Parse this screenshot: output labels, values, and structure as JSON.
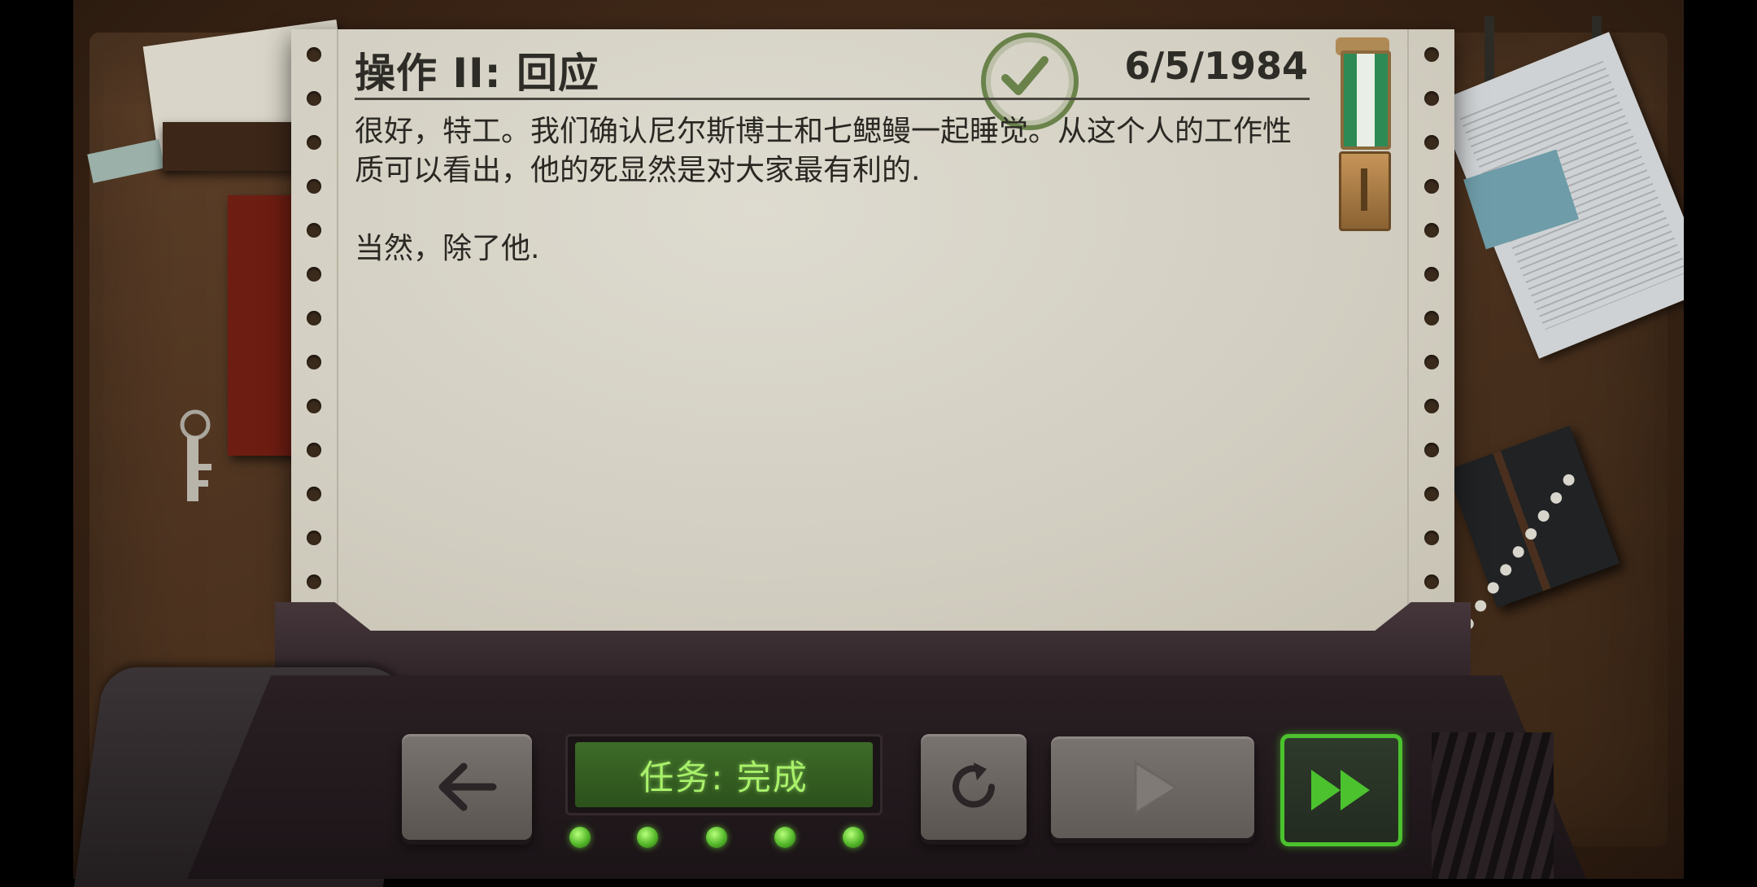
{
  "document": {
    "title": "操作 II: 回应",
    "date": "6/5/1984",
    "body": "很好，特工。我们确认尼尔斯博士和七鳃鳗一起睡觉。从这个人的工作性质可以看出，他的死显然是对大家最有利的.\n\n当然，除了他."
  },
  "status_display": {
    "text": "任务: 完成"
  },
  "controls": {
    "back_icon": "arrow-left-icon",
    "retry_icon": "retry-icon",
    "play_icon": "play-icon",
    "fast_forward_icon": "fast-forward-icon",
    "status_led_count": 5
  },
  "colors": {
    "lcd_text": "#a8f06a",
    "fast_forward_border": "#4cc22e",
    "stamp": "#4f6f2c"
  }
}
